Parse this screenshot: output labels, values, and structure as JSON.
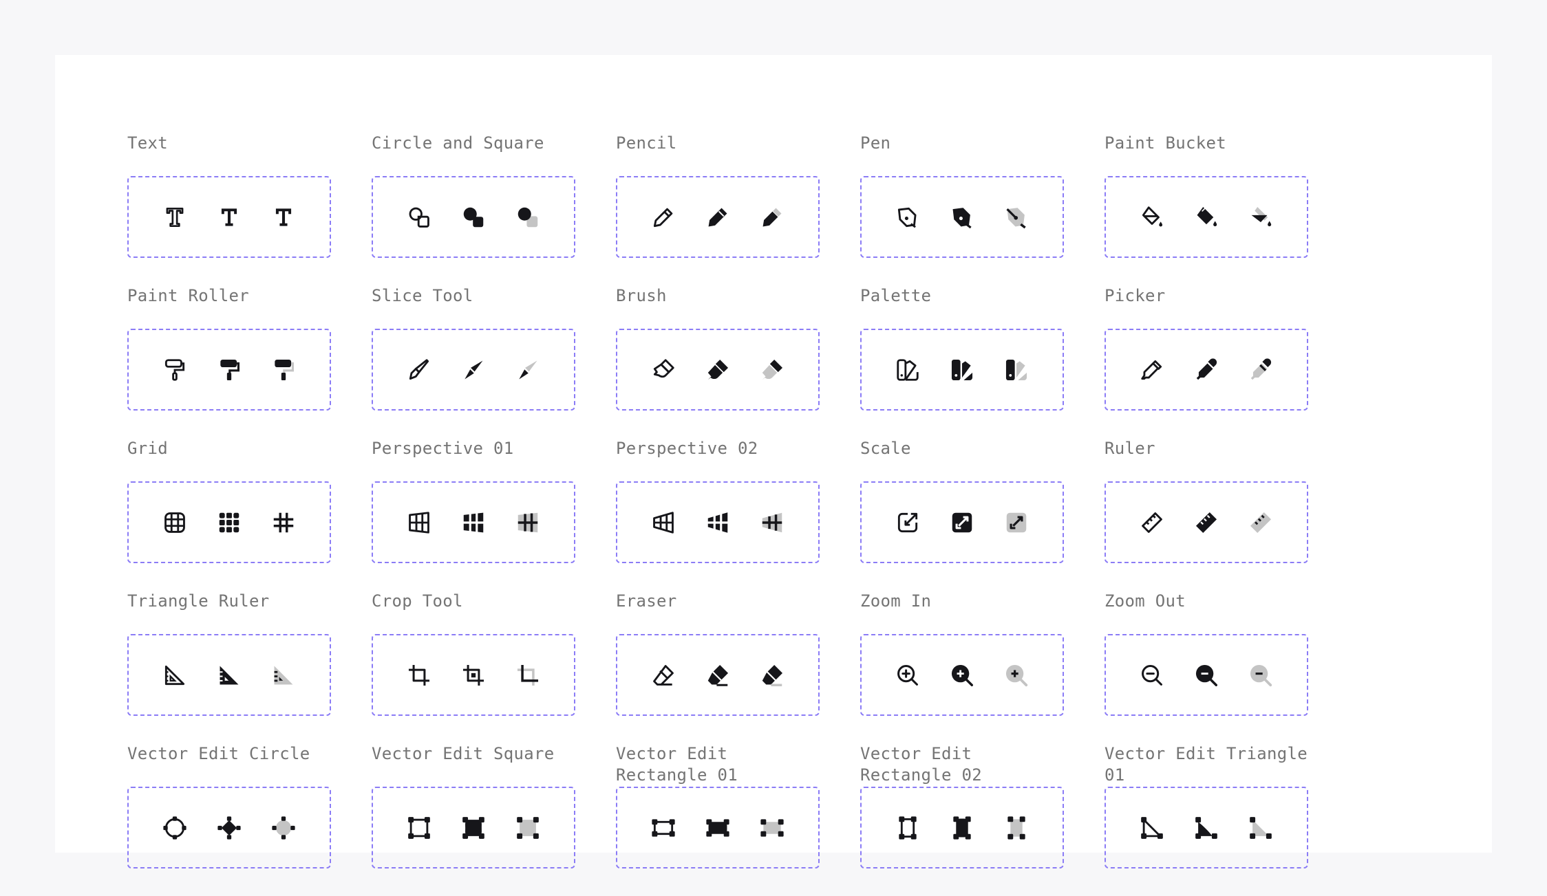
{
  "colors": {
    "page_bg": "#f7f7f9",
    "canvas_bg": "#ffffff",
    "label": "#747474",
    "dash_border": "#8b7cf6",
    "icon_dark": "#16161a",
    "icon_light": "#c4c4c4"
  },
  "icon_sets": [
    {
      "label": "Text",
      "icon": "text"
    },
    {
      "label": "Circle and Square",
      "icon": "circle-square"
    },
    {
      "label": "Pencil",
      "icon": "pencil"
    },
    {
      "label": "Pen",
      "icon": "pen"
    },
    {
      "label": "Paint Bucket",
      "icon": "paint-bucket"
    },
    {
      "label": "Paint Roller",
      "icon": "paint-roller"
    },
    {
      "label": "Slice Tool",
      "icon": "slice-tool"
    },
    {
      "label": "Brush",
      "icon": "brush"
    },
    {
      "label": "Palette",
      "icon": "palette"
    },
    {
      "label": "Picker",
      "icon": "picker"
    },
    {
      "label": "Grid",
      "icon": "grid"
    },
    {
      "label": "Perspective 01",
      "icon": "perspective-01"
    },
    {
      "label": "Perspective 02",
      "icon": "perspective-02"
    },
    {
      "label": "Scale",
      "icon": "scale"
    },
    {
      "label": "Ruler",
      "icon": "ruler"
    },
    {
      "label": "Triangle Ruler",
      "icon": "triangle-ruler"
    },
    {
      "label": "Crop Tool",
      "icon": "crop-tool"
    },
    {
      "label": "Eraser",
      "icon": "eraser"
    },
    {
      "label": "Zoom In",
      "icon": "zoom-in"
    },
    {
      "label": "Zoom Out",
      "icon": "zoom-out"
    },
    {
      "label": "Vector Edit Circle",
      "icon": "vector-edit-circle"
    },
    {
      "label": "Vector Edit Square",
      "icon": "vector-edit-square"
    },
    {
      "label": "Vector Edit Rectangle 01",
      "icon": "vector-edit-rectangle-01"
    },
    {
      "label": "Vector Edit Rectangle 02",
      "icon": "vector-edit-rectangle-02"
    },
    {
      "label": "Vector Edit Triangle 01",
      "icon": "vector-edit-triangle-01"
    }
  ],
  "variants": [
    "outline",
    "solid",
    "duotone"
  ]
}
